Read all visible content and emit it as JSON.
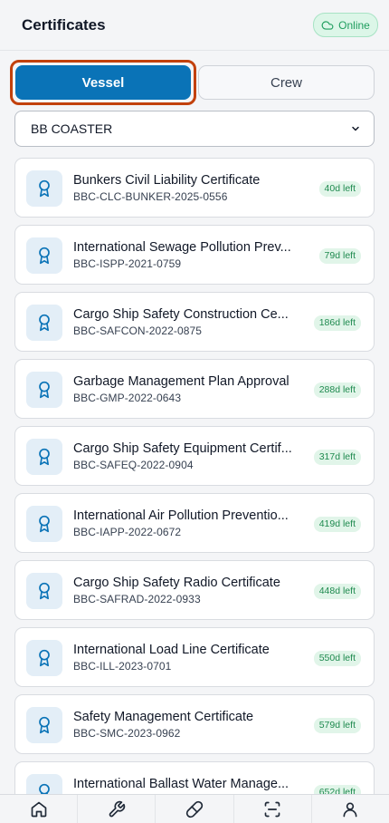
{
  "header": {
    "title": "Certificates",
    "status_label": "Online",
    "status_icon": "cloud-icon"
  },
  "tabs": {
    "vessel_label": "Vessel",
    "crew_label": "Crew",
    "active": "Vessel"
  },
  "vessel_select": {
    "selected": "BB COASTER"
  },
  "certificates": [
    {
      "title": "Bunkers Civil Liability Certificate",
      "code": "BBC-CLC-BUNKER-2025-0556",
      "days_left": "40d left"
    },
    {
      "title": "International Sewage Pollution Prev...",
      "code": "BBC-ISPP-2021-0759",
      "days_left": "79d left"
    },
    {
      "title": "Cargo Ship Safety Construction Ce...",
      "code": "BBC-SAFCON-2022-0875",
      "days_left": "186d left"
    },
    {
      "title": "Garbage Management Plan Approval",
      "code": "BBC-GMP-2022-0643",
      "days_left": "288d left"
    },
    {
      "title": "Cargo Ship Safety Equipment Certif...",
      "code": "BBC-SAFEQ-2022-0904",
      "days_left": "317d left"
    },
    {
      "title": "International Air Pollution Preventio...",
      "code": "BBC-IAPP-2022-0672",
      "days_left": "419d left"
    },
    {
      "title": "Cargo Ship Safety Radio Certificate",
      "code": "BBC-SAFRAD-2022-0933",
      "days_left": "448d left"
    },
    {
      "title": "International Load Line Certificate",
      "code": "BBC-ILL-2023-0701",
      "days_left": "550d left"
    },
    {
      "title": "Safety Management Certificate",
      "code": "BBC-SMC-2023-0962",
      "days_left": "579d left"
    },
    {
      "title": "International Ballast Water Manage...",
      "code": "",
      "days_left": "652d left"
    }
  ],
  "bottom_nav": [
    {
      "icon": "home-icon"
    },
    {
      "icon": "wrench-icon"
    },
    {
      "icon": "pill-icon"
    },
    {
      "icon": "scan-icon"
    },
    {
      "icon": "user-icon"
    }
  ],
  "colors": {
    "primary": "#0a73b7",
    "highlight_border": "#c2410c",
    "online_green": "#1f9e5e",
    "days_badge_bg": "#e1f5e9"
  }
}
